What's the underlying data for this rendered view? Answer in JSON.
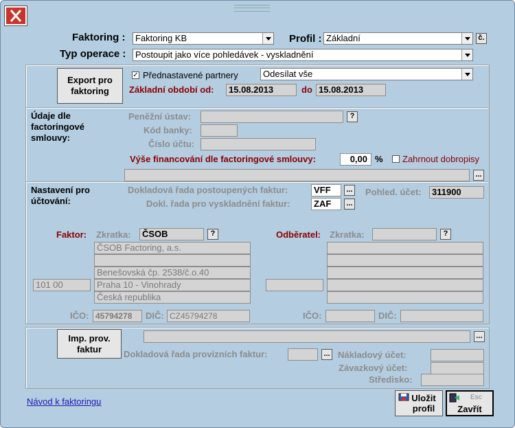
{
  "header": {
    "factoring_label": "Faktoring :",
    "factoring_value": "Faktoring KB",
    "profile_label": "Profil :",
    "profile_value": "Základní",
    "profile_btn": "č.",
    "operation_label": "Typ operace :",
    "operation_value": "Postoupit jako více pohledávek - vyskladnění"
  },
  "export": {
    "button_label": "Export pro faktoring",
    "preset_partners_label": "Přednastavené partnery",
    "preset_partners_checked": true,
    "send_value": "Odesílat vše",
    "period_from_label": "Základní období od:",
    "period_from": "15.08.2013",
    "period_to_label": "do",
    "period_to": "15.08.2013"
  },
  "contract": {
    "section_label": "Údaje dle factoringové smlouvy:",
    "bank_label": "Peněžní ústav:",
    "bank_value": "",
    "bank_code_label": "Kód banky:",
    "bank_code_value": "",
    "account_label": "Číslo účtu:",
    "account_value": "",
    "financing_label": "Výše financování dle factoringové smlouvy:",
    "financing_value": "0,00",
    "financing_unit": "%",
    "credit_notes_label": "Zahrnout dobropisy",
    "credit_notes_checked": false,
    "path_value": ""
  },
  "accounting": {
    "section_label": "Nastavení pro účtování:",
    "assigned_series_label": "Dokladová řada postoupených faktur:",
    "assigned_series_value": "VFF",
    "stockout_series_label": "Dokl. řada pro vyskladnění faktur:",
    "stockout_series_value": "ZAF",
    "receivable_label": "Pohled. účet:",
    "receivable_value": "311900"
  },
  "factor": {
    "label": "Faktor:",
    "short_label": "Zkratka:",
    "short_value": "ČSOB",
    "address_lines": [
      "ČSOB Factoring, a.s.",
      "",
      "Benešovská čp. 2538/č.o.40",
      "Praha 10 - Vinohrady",
      "Česká republika"
    ],
    "zip": "101 00",
    "ico_label": "IČO:",
    "ico_value": "45794278",
    "dic_label": "DIČ:",
    "dic_value": "CZ45794278"
  },
  "customer": {
    "label": "Odběratel:",
    "short_label": "Zkratka:",
    "short_value": "",
    "address_lines": [
      "",
      "",
      "",
      "",
      ""
    ],
    "zip": "",
    "ico_label": "IČO:",
    "ico_value": "",
    "dic_label": "DIČ:",
    "dic_value": ""
  },
  "import": {
    "button_label": "Imp. prov. faktur",
    "path_value": "",
    "series_label": "Dokladová řada provizních faktur:",
    "series_value": "",
    "cost_account_label": "Nákladový účet:",
    "cost_account_value": "",
    "liability_account_label": "Závazkový účet:",
    "liability_account_value": "",
    "center_label": "Středisko:",
    "center_value": ""
  },
  "footer": {
    "help_link": "Návod k faktoringu",
    "save_label": "Uložit profil",
    "close_label": "Zavřít",
    "esc_hint": "Esc"
  },
  "colors": {
    "frame": "#b4cde1",
    "client": "#f0f0f0",
    "close_red": "#c8342a",
    "label_red": "#8b0000"
  },
  "icons": [
    "close-icon",
    "dropdown-arrow-icon",
    "save-icon",
    "exit-door-icon"
  ]
}
